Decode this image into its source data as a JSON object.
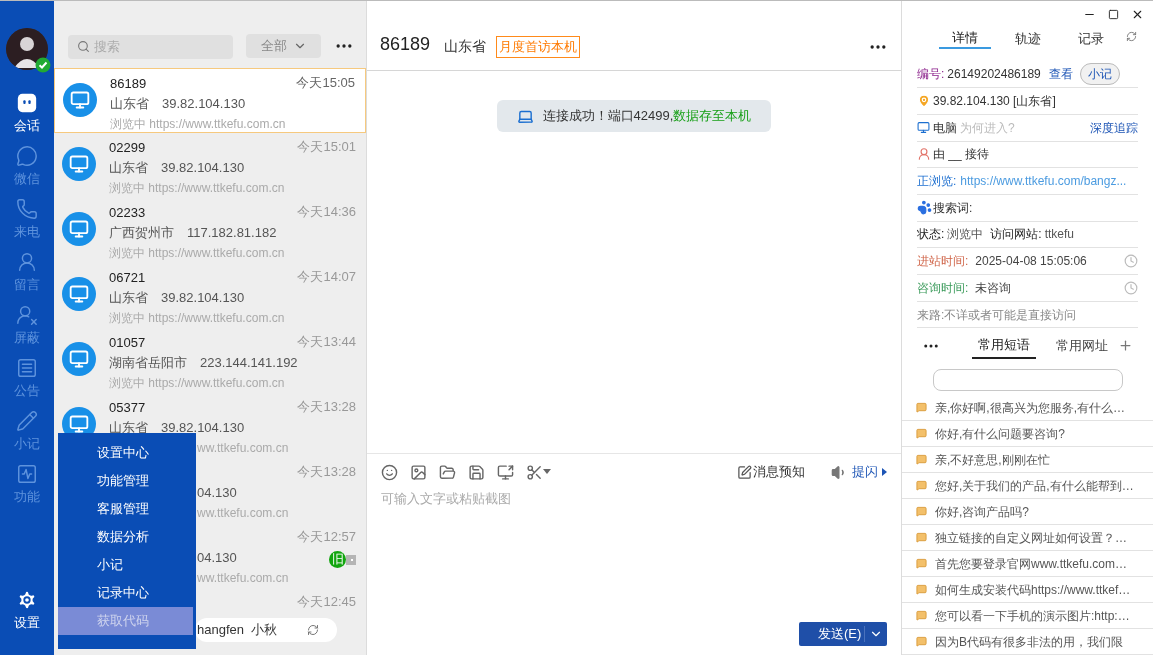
{
  "nav": {
    "items": [
      {
        "kind": "chat",
        "label": "会话",
        "selected": true
      },
      {
        "kind": "wechat",
        "label": "微信",
        "selected": false
      },
      {
        "kind": "phone",
        "label": "来电",
        "selected": false
      },
      {
        "kind": "message",
        "label": "留言",
        "selected": false
      },
      {
        "kind": "block",
        "label": "屏蔽",
        "selected": false
      },
      {
        "kind": "notice",
        "label": "公告",
        "selected": false
      },
      {
        "kind": "note",
        "label": "小记",
        "selected": false
      },
      {
        "kind": "feature",
        "label": "功能",
        "selected": false
      }
    ],
    "settings": {
      "label": "设置",
      "selected": true
    }
  },
  "session_list": {
    "search": {
      "placeholder": "搜索"
    },
    "filter": "全部",
    "rows": [
      {
        "selected": true,
        "time": "今天15:05",
        "lines": [
          {
            "kind": "id",
            "text": "86189"
          },
          {
            "kind": "location",
            "text": "山东省　39.82.104.130"
          },
          {
            "kind": "url",
            "text": "浏览中 https://www.ttkefu.com.cn"
          }
        ]
      },
      {
        "selected": false,
        "time": "今天15:01",
        "lines": [
          {
            "kind": "id",
            "text": "02299"
          },
          {
            "kind": "location",
            "text": "山东省　39.82.104.130"
          },
          {
            "kind": "url",
            "text": "浏览中 https://www.ttkefu.com.cn"
          }
        ]
      },
      {
        "selected": false,
        "time": "今天14:36",
        "lines": [
          {
            "kind": "id",
            "text": "02233"
          },
          {
            "kind": "location",
            "text": "广西贺州市　117.182.81.182"
          },
          {
            "kind": "url",
            "text": "浏览中 https://www.ttkefu.com.cn"
          }
        ]
      },
      {
        "selected": false,
        "time": "今天14:07",
        "lines": [
          {
            "kind": "id",
            "text": "06721"
          },
          {
            "kind": "location",
            "text": "山东省　39.82.104.130"
          },
          {
            "kind": "url",
            "text": "浏览中 https://www.ttkefu.com.cn"
          }
        ]
      },
      {
        "selected": false,
        "time": "今天13:44",
        "lines": [
          {
            "kind": "id",
            "text": "01057"
          },
          {
            "kind": "location",
            "text": "湖南省岳阳市　223.144.141.192"
          },
          {
            "kind": "url",
            "text": "浏览中 https://www.ttkefu.com.cn"
          }
        ]
      },
      {
        "selected": false,
        "time": "今天13:28",
        "lines": [
          {
            "kind": "id",
            "text": "05377"
          },
          {
            "kind": "location",
            "text": "山东省　39.82.104.130"
          },
          {
            "kind": "url_tail",
            "text": "ww.ttkefu.com.cn"
          }
        ]
      },
      {
        "selected": false,
        "time": "今天13:28",
        "lines": [
          {
            "kind": "location_tail",
            "text": "04.130"
          },
          {
            "kind": "url_tail",
            "text": "ww.ttkefu.com.cn"
          }
        ]
      },
      {
        "selected": false,
        "time": "今天12:57",
        "badge": "旧",
        "lines": [
          {
            "kind": "location_tail",
            "text": "04.130"
          },
          {
            "kind": "url_tail",
            "text": "ww.ttkefu.com.cn"
          }
        ]
      },
      {
        "selected": false,
        "time": "今天12:45",
        "lines": []
      }
    ],
    "agent_pill": "hangfen  小秋"
  },
  "settings_menu": {
    "items": [
      {
        "label": "设置中心",
        "selected": false
      },
      {
        "label": "功能管理",
        "selected": false
      },
      {
        "label": "客服管理",
        "selected": false
      },
      {
        "label": "数据分析",
        "selected": false
      },
      {
        "label": "小记",
        "selected": false
      },
      {
        "label": "记录中心",
        "selected": false
      },
      {
        "label": "获取代码",
        "selected": true
      }
    ]
  },
  "chat": {
    "title": "86189",
    "region": "山东省",
    "tag": "月度首访本机",
    "notice": {
      "text": "连接成功！端口42499,",
      "highlight": "数据存至本机"
    },
    "composer": {
      "preview": "消息预知",
      "flash": "提闪",
      "placeholder": "可输入文字或粘贴截图",
      "send": "发送(E)"
    }
  },
  "details": {
    "tabs": [
      {
        "label": "详情",
        "selected": true
      },
      {
        "label": "轨迹",
        "selected": false
      },
      {
        "label": "记录",
        "selected": false
      }
    ],
    "id_label": "编号:",
    "id_value": "26149202486189",
    "view_link": "查看",
    "note_button": "小记",
    "ip": "39.82.104.130 [山东省]",
    "device": "电脑",
    "device_hint": "为何进入?",
    "deep_track": "深度追踪",
    "agent": "由 __ 接待",
    "browsing_label": "正浏览:",
    "browsing_url": "https://www.ttkefu.com/bangz...",
    "keyword_label": "搜索词:",
    "status_label": "状态:",
    "status_value": "浏览中",
    "site_label": "访问网站:",
    "site_value": "ttkefu",
    "enter_label": "进站时间:",
    "enter_value": "2025-04-08 15:05:06",
    "consult_label": "咨询时间:",
    "consult_value": "未咨询",
    "referrer": "来路:不详或者可能是直接访问"
  },
  "quick": {
    "tabs": [
      {
        "label": "常用短语",
        "selected": true
      },
      {
        "label": "常用网址",
        "selected": false
      }
    ],
    "phrases": [
      "亲,你好啊,很高兴为您服务,有什么…",
      "你好,有什么问题要咨询?",
      "亲,不好意思,刚刚在忙",
      "您好,关于我们的产品,有什么能帮到…",
      "你好,咨询产品吗?",
      "独立链接的自定义网址如何设置？…",
      "首先您要登录官网www.ttkefu.com…",
      "如何生成安装代码https://www.ttkef…",
      "您可以看一下手机的演示图片:http:…",
      "因为B代码有很多非法的用，我们限"
    ]
  }
}
